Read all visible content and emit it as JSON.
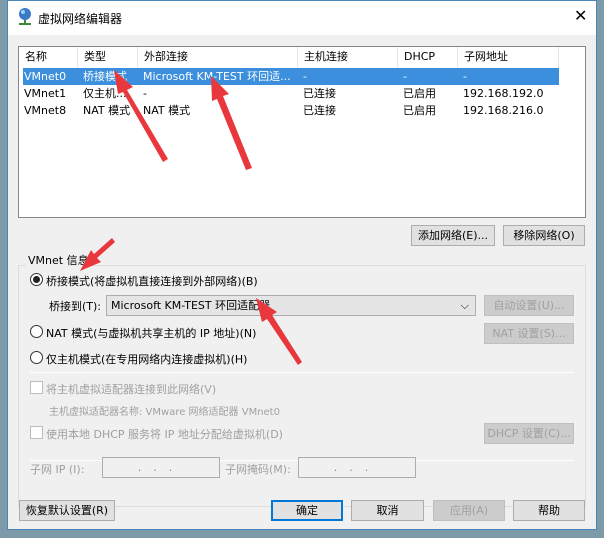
{
  "window": {
    "title": "虚拟网络编辑器",
    "close": "✕"
  },
  "table": {
    "headers": [
      "名称",
      "类型",
      "外部连接",
      "主机连接",
      "DHCP",
      "子网地址"
    ],
    "rows": [
      [
        "VMnet0",
        "桥接模式",
        "Microsoft KM-TEST 环回适...",
        "-",
        "-",
        "-"
      ],
      [
        "VMnet1",
        "仅主机...",
        "-",
        "已连接",
        "已启用",
        "192.168.192.0"
      ],
      [
        "VMnet8",
        "NAT 模式",
        "NAT 模式",
        "已连接",
        "已启用",
        "192.168.216.0"
      ]
    ]
  },
  "buttons": {
    "add": "添加网络(E)...",
    "remove": "移除网络(O)",
    "auto": "自动设置(U)...",
    "nat": "NAT 设置(S)...",
    "dhcp": "DHCP 设置(C)...",
    "restore": "恢复默认设置(R)",
    "ok": "确定",
    "cancel": "取消",
    "apply": "应用(A)",
    "help": "帮助"
  },
  "vmnet": {
    "group_label": "VMnet 信息",
    "bridged": "桥接模式(将虚拟机直接连接到外部网络)(B)",
    "bridge_to_label": "桥接到(T):",
    "bridge_to_value": "Microsoft KM-TEST 环回适配器",
    "nat": "NAT 模式(与虚拟机共享主机的 IP 地址)(N)",
    "host_only": "仅主机模式(在专用网络内连接虚拟机)(H)",
    "connect_adapter": "将主机虚拟适配器连接到此网络(V)",
    "adapter_name": "主机虚拟适配器名称: VMware 网络适配器 VMnet0",
    "use_dhcp": "使用本地 DHCP 服务将 IP 地址分配给虚拟机(D)",
    "subnet_ip_label": "子网 IP (I):",
    "subnet_mask_label": "子网掩码(M):",
    "ip_placeholder": "...",
    "selected_mode": "bridged"
  },
  "colors": {
    "selection": "#3b8fdc",
    "annotation": "#e8383d"
  }
}
